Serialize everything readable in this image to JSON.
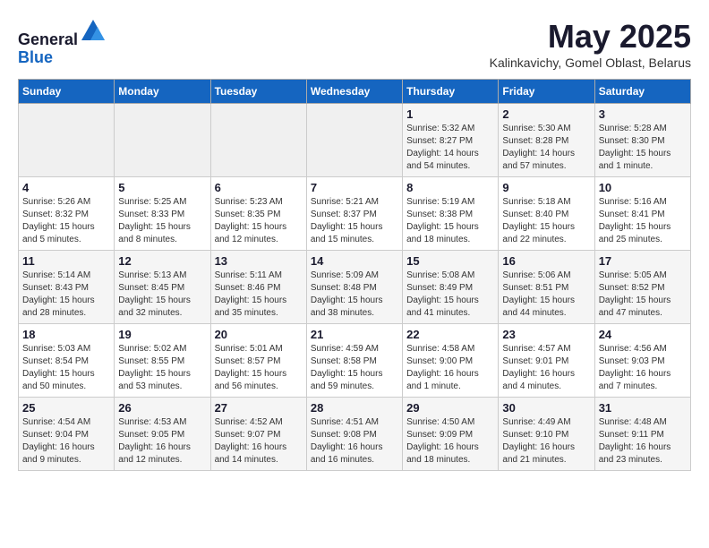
{
  "header": {
    "logo_general": "General",
    "logo_blue": "Blue",
    "month_year": "May 2025",
    "location": "Kalinkavichy, Gomel Oblast, Belarus"
  },
  "weekdays": [
    "Sunday",
    "Monday",
    "Tuesday",
    "Wednesday",
    "Thursday",
    "Friday",
    "Saturday"
  ],
  "weeks": [
    [
      {
        "day": "",
        "info": ""
      },
      {
        "day": "",
        "info": ""
      },
      {
        "day": "",
        "info": ""
      },
      {
        "day": "",
        "info": ""
      },
      {
        "day": "1",
        "info": "Sunrise: 5:32 AM\nSunset: 8:27 PM\nDaylight: 14 hours\nand 54 minutes."
      },
      {
        "day": "2",
        "info": "Sunrise: 5:30 AM\nSunset: 8:28 PM\nDaylight: 14 hours\nand 57 minutes."
      },
      {
        "day": "3",
        "info": "Sunrise: 5:28 AM\nSunset: 8:30 PM\nDaylight: 15 hours\nand 1 minute."
      }
    ],
    [
      {
        "day": "4",
        "info": "Sunrise: 5:26 AM\nSunset: 8:32 PM\nDaylight: 15 hours\nand 5 minutes."
      },
      {
        "day": "5",
        "info": "Sunrise: 5:25 AM\nSunset: 8:33 PM\nDaylight: 15 hours\nand 8 minutes."
      },
      {
        "day": "6",
        "info": "Sunrise: 5:23 AM\nSunset: 8:35 PM\nDaylight: 15 hours\nand 12 minutes."
      },
      {
        "day": "7",
        "info": "Sunrise: 5:21 AM\nSunset: 8:37 PM\nDaylight: 15 hours\nand 15 minutes."
      },
      {
        "day": "8",
        "info": "Sunrise: 5:19 AM\nSunset: 8:38 PM\nDaylight: 15 hours\nand 18 minutes."
      },
      {
        "day": "9",
        "info": "Sunrise: 5:18 AM\nSunset: 8:40 PM\nDaylight: 15 hours\nand 22 minutes."
      },
      {
        "day": "10",
        "info": "Sunrise: 5:16 AM\nSunset: 8:41 PM\nDaylight: 15 hours\nand 25 minutes."
      }
    ],
    [
      {
        "day": "11",
        "info": "Sunrise: 5:14 AM\nSunset: 8:43 PM\nDaylight: 15 hours\nand 28 minutes."
      },
      {
        "day": "12",
        "info": "Sunrise: 5:13 AM\nSunset: 8:45 PM\nDaylight: 15 hours\nand 32 minutes."
      },
      {
        "day": "13",
        "info": "Sunrise: 5:11 AM\nSunset: 8:46 PM\nDaylight: 15 hours\nand 35 minutes."
      },
      {
        "day": "14",
        "info": "Sunrise: 5:09 AM\nSunset: 8:48 PM\nDaylight: 15 hours\nand 38 minutes."
      },
      {
        "day": "15",
        "info": "Sunrise: 5:08 AM\nSunset: 8:49 PM\nDaylight: 15 hours\nand 41 minutes."
      },
      {
        "day": "16",
        "info": "Sunrise: 5:06 AM\nSunset: 8:51 PM\nDaylight: 15 hours\nand 44 minutes."
      },
      {
        "day": "17",
        "info": "Sunrise: 5:05 AM\nSunset: 8:52 PM\nDaylight: 15 hours\nand 47 minutes."
      }
    ],
    [
      {
        "day": "18",
        "info": "Sunrise: 5:03 AM\nSunset: 8:54 PM\nDaylight: 15 hours\nand 50 minutes."
      },
      {
        "day": "19",
        "info": "Sunrise: 5:02 AM\nSunset: 8:55 PM\nDaylight: 15 hours\nand 53 minutes."
      },
      {
        "day": "20",
        "info": "Sunrise: 5:01 AM\nSunset: 8:57 PM\nDaylight: 15 hours\nand 56 minutes."
      },
      {
        "day": "21",
        "info": "Sunrise: 4:59 AM\nSunset: 8:58 PM\nDaylight: 15 hours\nand 59 minutes."
      },
      {
        "day": "22",
        "info": "Sunrise: 4:58 AM\nSunset: 9:00 PM\nDaylight: 16 hours\nand 1 minute."
      },
      {
        "day": "23",
        "info": "Sunrise: 4:57 AM\nSunset: 9:01 PM\nDaylight: 16 hours\nand 4 minutes."
      },
      {
        "day": "24",
        "info": "Sunrise: 4:56 AM\nSunset: 9:03 PM\nDaylight: 16 hours\nand 7 minutes."
      }
    ],
    [
      {
        "day": "25",
        "info": "Sunrise: 4:54 AM\nSunset: 9:04 PM\nDaylight: 16 hours\nand 9 minutes."
      },
      {
        "day": "26",
        "info": "Sunrise: 4:53 AM\nSunset: 9:05 PM\nDaylight: 16 hours\nand 12 minutes."
      },
      {
        "day": "27",
        "info": "Sunrise: 4:52 AM\nSunset: 9:07 PM\nDaylight: 16 hours\nand 14 minutes."
      },
      {
        "day": "28",
        "info": "Sunrise: 4:51 AM\nSunset: 9:08 PM\nDaylight: 16 hours\nand 16 minutes."
      },
      {
        "day": "29",
        "info": "Sunrise: 4:50 AM\nSunset: 9:09 PM\nDaylight: 16 hours\nand 18 minutes."
      },
      {
        "day": "30",
        "info": "Sunrise: 4:49 AM\nSunset: 9:10 PM\nDaylight: 16 hours\nand 21 minutes."
      },
      {
        "day": "31",
        "info": "Sunrise: 4:48 AM\nSunset: 9:11 PM\nDaylight: 16 hours\nand 23 minutes."
      }
    ]
  ]
}
